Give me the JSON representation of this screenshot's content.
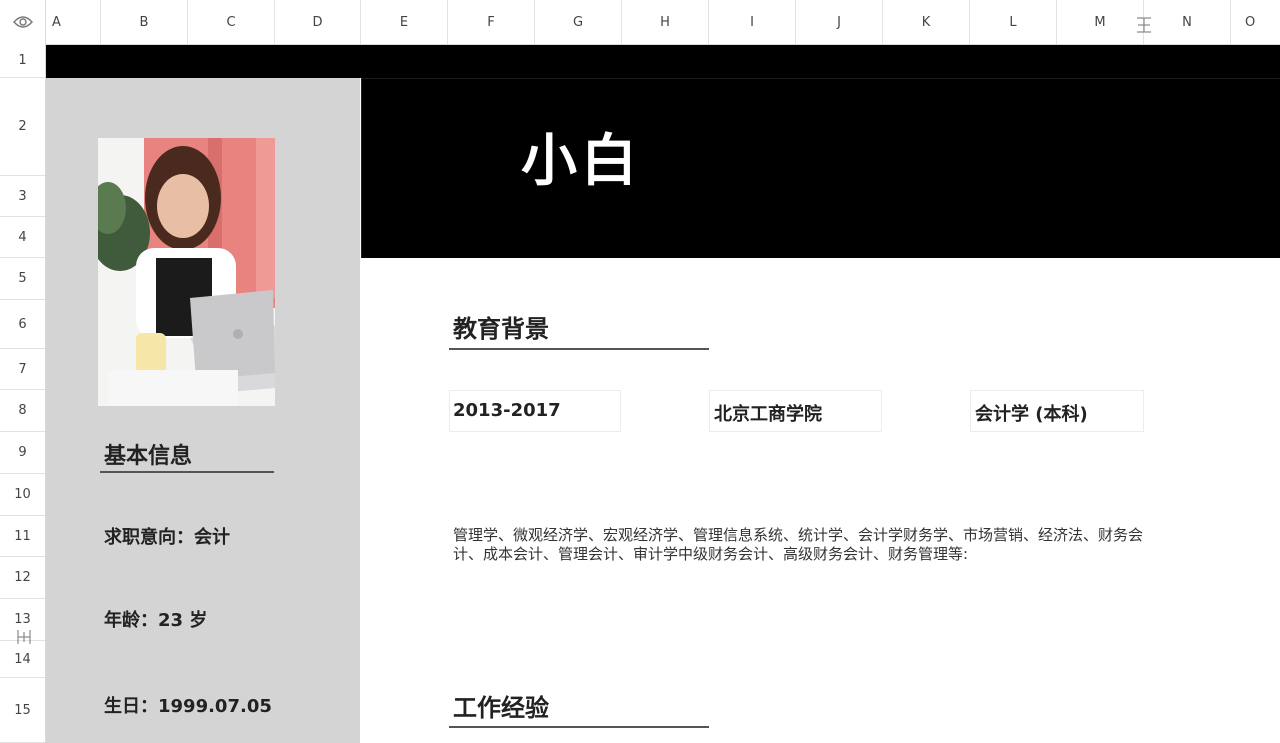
{
  "columns": [
    "A",
    "B",
    "C",
    "D",
    "E",
    "F",
    "G",
    "H",
    "I",
    "J",
    "K",
    "L",
    "M",
    "N",
    "O"
  ],
  "rows": [
    "1",
    "2",
    "3",
    "4",
    "5",
    "6",
    "7",
    "8",
    "9",
    "10",
    "11",
    "12",
    "13",
    "14",
    "15"
  ],
  "resume": {
    "name": "小白",
    "sidebar": {
      "basic_info_title": "基本信息",
      "job_intent": "求职意向：会计",
      "age": "年龄：23 岁",
      "birthday": "生日：1999.07.05"
    },
    "education": {
      "title": "教育背景",
      "period": "2013-2017",
      "school": "北京工商学院",
      "major": "会计学 (本科)",
      "courses": "管理学、微观经济学、宏观经济学、管理信息系统、统计学、会计学财务学、市场营销、经济法、财务会计、成本会计、管理会计、审计学中级财务会计、高级财务会计、财务管理等:"
    },
    "work": {
      "title": "工作经验"
    }
  },
  "icons": {
    "visibility": "eye-icon",
    "column_resize": "column-resize-icon",
    "row_resize": "row-resize-icon"
  }
}
